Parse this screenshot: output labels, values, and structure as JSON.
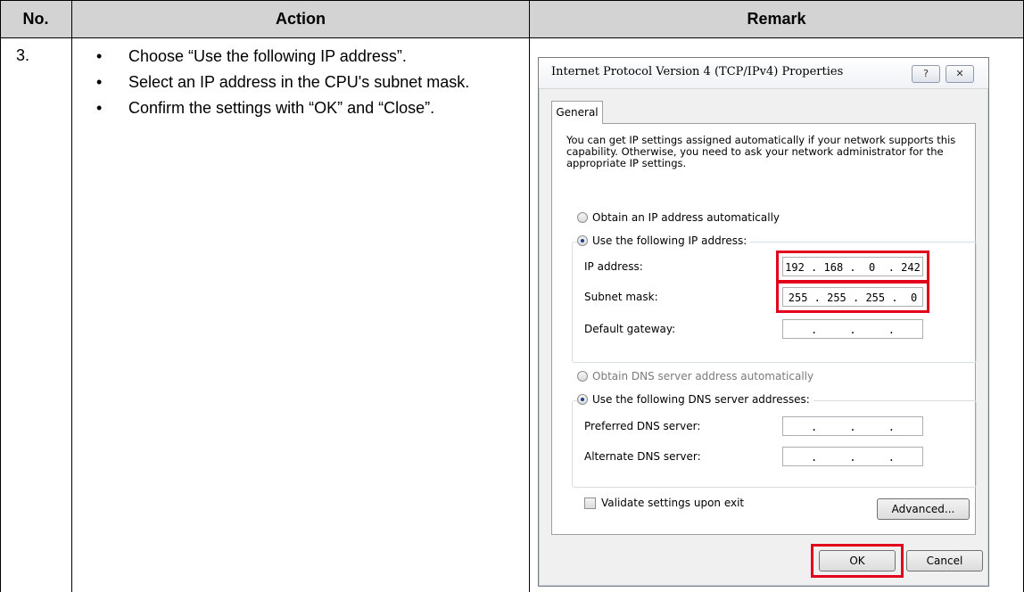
{
  "table": {
    "headers": {
      "no": "No.",
      "action": "Action",
      "remark": "Remark"
    },
    "row": {
      "number": "3.",
      "bullets": [
        "Choose “Use the following IP address”.",
        "Select an IP address in the CPU's subnet mask.",
        "Confirm the settings with “OK” and “Close”."
      ]
    }
  },
  "dialog": {
    "title": "Internet Protocol Version 4 (TCP/IPv4) Properties",
    "help_label": "?",
    "close_label": "✕",
    "tab_general": "General",
    "intro": "You can get IP settings assigned automatically if your network supports this capability. Otherwise, you need to ask your network administrator for the appropriate IP settings.",
    "obtain_ip_auto": "Obtain an IP address automatically",
    "use_following_ip": "Use the following IP address:",
    "ip_address_label": "IP address:",
    "ip_address_value": "192 . 168 .  0  . 242",
    "subnet_mask_label": "Subnet mask:",
    "subnet_mask_value": "255 . 255 . 255 .  0",
    "default_gateway_label": "Default gateway:",
    "default_gateway_value": "  .     .     .  ",
    "obtain_dns_auto": "Obtain DNS server address automatically",
    "use_following_dns": "Use the following DNS server addresses:",
    "preferred_dns_label": "Preferred DNS server:",
    "preferred_dns_value": "  .     .     .  ",
    "alternate_dns_label": "Alternate DNS server:",
    "alternate_dns_value": "  .     .     .  ",
    "validate_label": "Validate settings upon exit",
    "advanced_label": "Advanced...",
    "ok_label": "OK",
    "cancel_label": "Cancel"
  },
  "colors": {
    "header_bg": "#d3d3d3",
    "highlight": "#e3001b"
  }
}
